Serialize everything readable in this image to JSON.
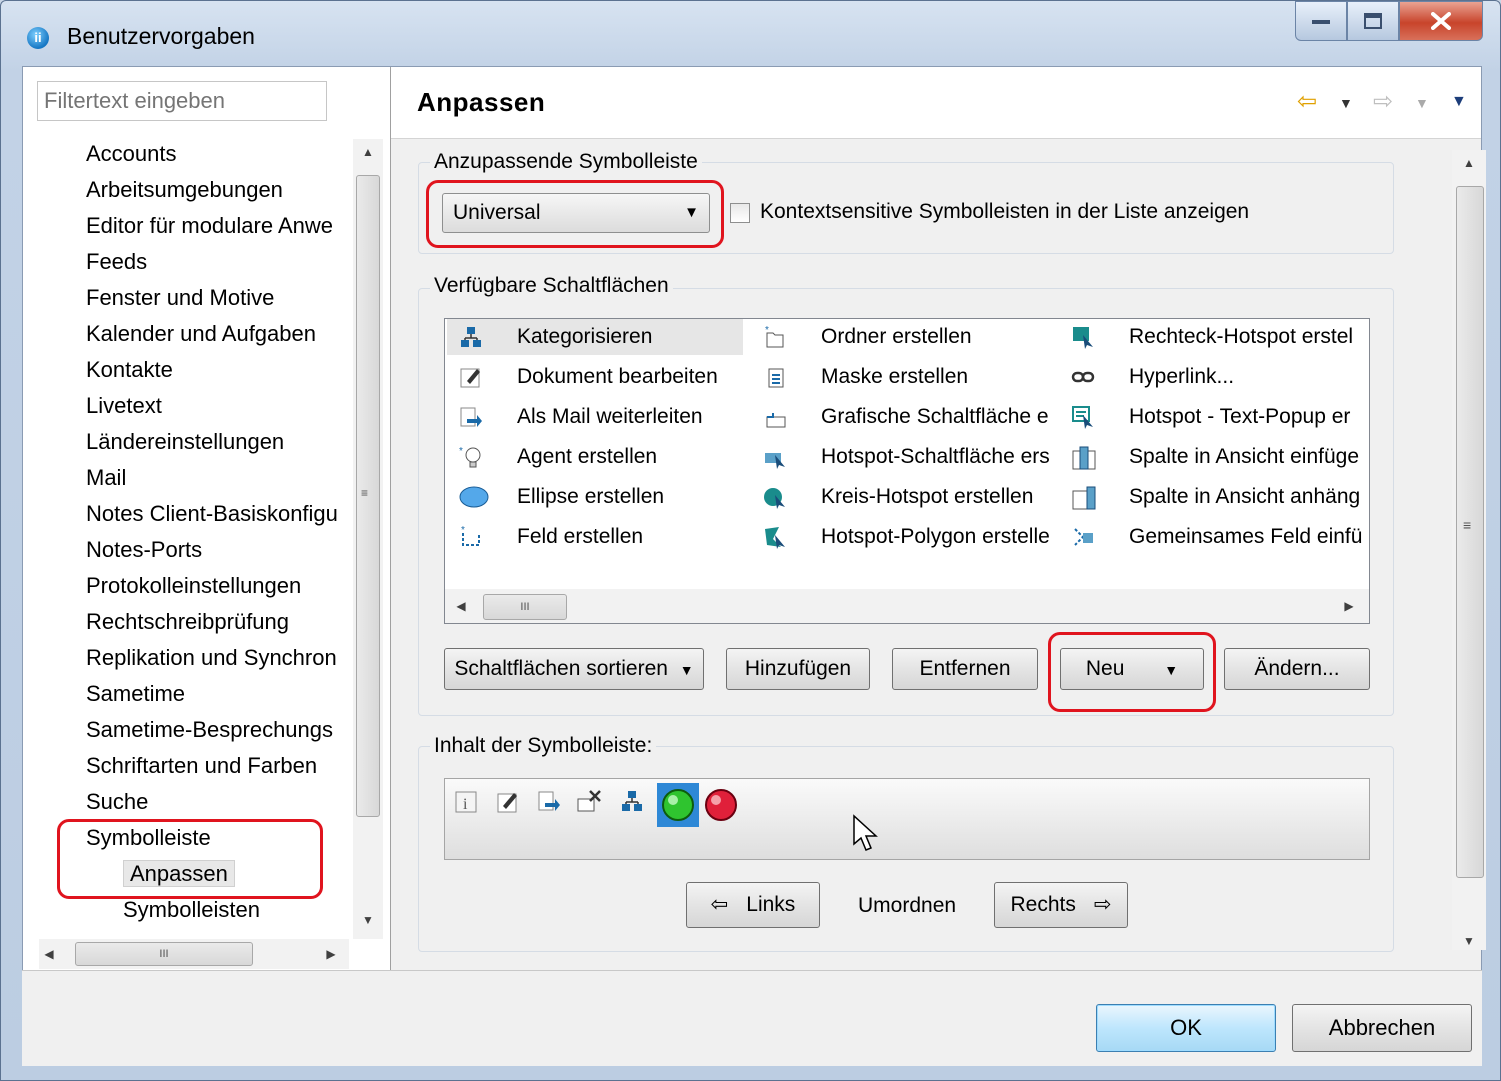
{
  "window": {
    "title": "Benutzervorgaben",
    "icon": "notes-app-icon",
    "controls": {
      "minimize": "minimize-icon",
      "maximize": "maximize-icon",
      "close": "close-icon"
    }
  },
  "nav": {
    "filter_placeholder": "Filtertext eingeben",
    "items": [
      {
        "label": "Accounts",
        "level": 0
      },
      {
        "label": "Arbeitsumgebungen",
        "level": 0
      },
      {
        "label": "Editor für modulare Anwe",
        "level": 0
      },
      {
        "label": "Feeds",
        "level": 0
      },
      {
        "label": "Fenster und Motive",
        "level": 0
      },
      {
        "label": "Kalender und Aufgaben",
        "level": 0
      },
      {
        "label": "Kontakte",
        "level": 0
      },
      {
        "label": "Livetext",
        "level": 0
      },
      {
        "label": "Ländereinstellungen",
        "level": 0
      },
      {
        "label": "Mail",
        "level": 0
      },
      {
        "label": "Notes Client-Basiskonfigu",
        "level": 0
      },
      {
        "label": "Notes-Ports",
        "level": 0
      },
      {
        "label": "Protokolleinstellungen",
        "level": 0
      },
      {
        "label": "Rechtschreibprüfung",
        "level": 0
      },
      {
        "label": "Replikation und Synchron",
        "level": 0
      },
      {
        "label": "Sametime",
        "level": 0
      },
      {
        "label": "Sametime-Besprechungs",
        "level": 0
      },
      {
        "label": "Schriftarten und Farben",
        "level": 0
      },
      {
        "label": "Suche",
        "level": 0
      },
      {
        "label": "Symbolleiste",
        "level": 0
      },
      {
        "label": "Anpassen",
        "level": 1,
        "selected": true
      },
      {
        "label": "Symbolleisten",
        "level": 1
      }
    ],
    "hscroll_grip": "III"
  },
  "page": {
    "title": "Anpassen",
    "nav_icons": [
      "back-arrow-icon",
      "dropdown-icon",
      "forward-arrow-icon",
      "dropdown-icon",
      "view-menu-icon"
    ]
  },
  "toolbar_select": {
    "group_label": "Anzupassende Symbolleiste",
    "selected": "Universal",
    "checkbox_label": "Kontextsensitive Symbolleisten in der Liste anzeigen",
    "checkbox_checked": false
  },
  "available": {
    "group_label": "Verfügbare Schaltflächen",
    "columns": [
      [
        {
          "icon": "categorize-icon",
          "label": "Kategorisieren",
          "selected": true
        },
        {
          "icon": "edit-document-icon",
          "label": "Dokument bearbeiten"
        },
        {
          "icon": "forward-mail-icon",
          "label": "Als Mail weiterleiten"
        },
        {
          "icon": "agent-icon",
          "label": "Agent erstellen"
        },
        {
          "icon": "ellipse-icon",
          "label": "Ellipse erstellen"
        },
        {
          "icon": "field-icon",
          "label": "Feld erstellen"
        }
      ],
      [
        {
          "icon": "new-folder-icon",
          "label": "Ordner erstellen"
        },
        {
          "icon": "new-form-icon",
          "label": "Maske erstellen"
        },
        {
          "icon": "graphic-button-icon",
          "label": "Grafische Schaltfläche e"
        },
        {
          "icon": "hotspot-button-icon",
          "label": "Hotspot-Schaltfläche ers"
        },
        {
          "icon": "circle-hotspot-icon",
          "label": "Kreis-Hotspot erstellen"
        },
        {
          "icon": "polygon-hotspot-icon",
          "label": "Hotspot-Polygon erstelle"
        }
      ],
      [
        {
          "icon": "rect-hotspot-icon",
          "label": "Rechteck-Hotspot erstel"
        },
        {
          "icon": "hyperlink-icon",
          "label": "Hyperlink..."
        },
        {
          "icon": "text-popup-icon",
          "label": "Hotspot - Text-Popup er"
        },
        {
          "icon": "insert-column-icon",
          "label": "Spalte in Ansicht einfüge"
        },
        {
          "icon": "append-column-icon",
          "label": "Spalte in Ansicht anhäng"
        },
        {
          "icon": "shared-field-icon",
          "label": "Gemeinsames Feld einfü"
        }
      ]
    ],
    "hscroll_grip": "III",
    "buttons": {
      "sort": "Schaltflächen sortieren",
      "add": "Hinzufügen",
      "remove": "Entfernen",
      "new": "Neu",
      "change": "Ändern..."
    }
  },
  "contents": {
    "group_label": "Inhalt der Symbolleiste:",
    "icons": [
      "info-icon",
      "edit-icon",
      "forward-icon",
      "delete-icon",
      "categorize-icon",
      "green-ball-icon",
      "red-ball-icon"
    ],
    "reorder_label": "Umordnen",
    "left_button": "Links",
    "right_button": "Rechts"
  },
  "dialog": {
    "ok": "OK",
    "cancel": "Abbrechen"
  }
}
